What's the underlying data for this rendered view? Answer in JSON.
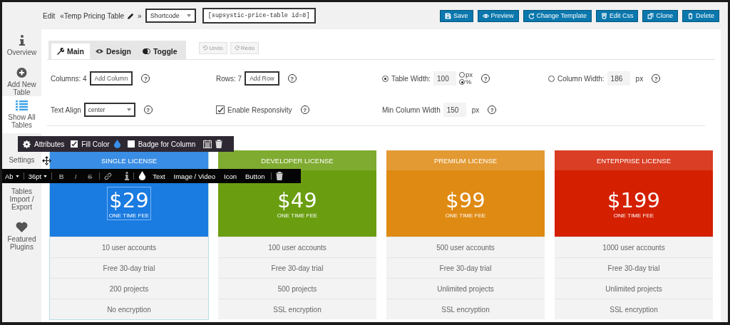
{
  "header": {
    "edit_label": "Edit",
    "table_name": "«Temp Pricing Table",
    "name_end": "»",
    "shortcode_select": "Shortcode",
    "shortcode": "[supsystic-price-table id=8]"
  },
  "actions": [
    {
      "label": "Save",
      "kind": "save"
    },
    {
      "label": "Preview",
      "kind": "preview"
    },
    {
      "label": "Change Template",
      "kind": "template"
    },
    {
      "label": "Edit Css",
      "kind": "css"
    },
    {
      "label": "Clone",
      "kind": "clone"
    },
    {
      "label": "Delete",
      "kind": "delete"
    }
  ],
  "sidebar": [
    {
      "label": "Overview",
      "kind": "info",
      "selected": false
    },
    {
      "label": "Add New Table",
      "kind": "add",
      "selected": false
    },
    {
      "label": "Show All Tables",
      "kind": "list",
      "selected": true
    },
    {
      "label": "Settings",
      "kind": "settings",
      "selected": false
    },
    {
      "label": "Tables Import / Export",
      "kind": "import",
      "selected": false
    },
    {
      "label": "Featured Plugins",
      "kind": "heart",
      "selected": false
    }
  ],
  "tabs": [
    {
      "label": "Main",
      "kind": "wrench",
      "selected": true
    },
    {
      "label": "Design",
      "kind": "eye",
      "selected": false
    },
    {
      "label": "Toggle",
      "kind": "toggle",
      "selected": false
    }
  ],
  "history": [
    {
      "label": "Undo",
      "kind": "undo"
    },
    {
      "label": "Redo",
      "kind": "redo"
    }
  ],
  "settings": {
    "columns": {
      "label": "Columns: 4",
      "button": "Add Column",
      "help": "?"
    },
    "rows": {
      "label": "Rows: 7",
      "button": "Add Row",
      "help": "?"
    },
    "table_width": {
      "label": "Table Width:",
      "selected": true,
      "value": "100",
      "units": [
        {
          "label": "px",
          "selected": false
        },
        {
          "label": "%",
          "selected": true
        }
      ],
      "help": "?"
    },
    "column_width": {
      "label": "Column Width:",
      "selected": false,
      "value": "186",
      "unit": "px",
      "help": "?"
    },
    "text_align": {
      "label": "Text Align",
      "value": "center",
      "help": "?"
    },
    "responsivity": {
      "label": "Enable Responsivity",
      "checked": true,
      "help": "?"
    },
    "min_column_width": {
      "label": "Min Column Width",
      "value": "150",
      "unit": "px",
      "help": "?"
    }
  },
  "column_toolbar": {
    "attributes": "Attributes",
    "fill_color": {
      "label": "Fill Color",
      "checked": true
    },
    "badge": {
      "label": "Badge for Column",
      "checked": false
    }
  },
  "text_toolbar": {
    "style": "Ab",
    "size": "36pt",
    "formats": [
      {
        "label": "B",
        "kind": "bold"
      },
      {
        "label": "I",
        "kind": "italic"
      },
      {
        "label": "S",
        "kind": "strike"
      }
    ],
    "inserts": [
      "Text",
      "Image / Video",
      "Icon",
      "Button"
    ]
  },
  "cards": [
    {
      "title": "SINGLE LICENSE",
      "price": "$29",
      "fee": "ONE TIME FEE",
      "color": "#1a7be0",
      "selected": true,
      "features": [
        "10 user accounts",
        "Free 30-day trial",
        "200 projects",
        "No encryption"
      ]
    },
    {
      "title": "DEVELOPER LICENSE",
      "price": "$49",
      "fee": "ONE TIME FEE",
      "color": "#6a9e10",
      "selected": false,
      "features": [
        "100 user accounts",
        "Free 30-day trial",
        "500 projects",
        "SSL encryption"
      ]
    },
    {
      "title": "PREMIUM LICENSE",
      "price": "$99",
      "fee": "ONE TIME FEE",
      "color": "#df8a12",
      "selected": false,
      "features": [
        "500 user accounts",
        "Free 30-day trial",
        "Unlimited projects",
        "SSL encryption"
      ]
    },
    {
      "title": "ENTERPRISE LICENSE",
      "price": "$199",
      "fee": "ONE TIME FEE",
      "color": "#d41f00",
      "selected": false,
      "features": [
        "1000 user accounts",
        "Free 30-day trial",
        "Unlimited projects",
        "SSL encryption"
      ]
    }
  ]
}
